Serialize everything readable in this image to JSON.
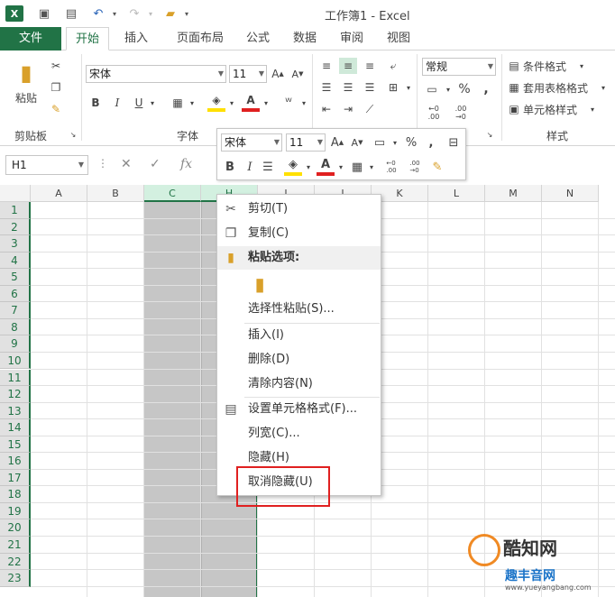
{
  "window": {
    "title": "工作簿1 - Excel"
  },
  "tabs": [
    {
      "label": "文件"
    },
    {
      "label": "开始"
    },
    {
      "label": "插入"
    },
    {
      "label": "页面布局"
    },
    {
      "label": "公式"
    },
    {
      "label": "数据"
    },
    {
      "label": "审阅"
    },
    {
      "label": "视图"
    }
  ],
  "ribbon": {
    "paste_label": "粘贴",
    "clipboard_group": "剪贴板",
    "font_name": "宋体",
    "font_size": "11",
    "font_group": "字体",
    "bold": "B",
    "italic": "I",
    "underline": "U",
    "font_color_letter": "A",
    "number_format": "常规",
    "percent": "%",
    "comma": ",",
    "cond_format": "条件格式",
    "table_format": "套用表格格式",
    "cell_style": "单元格样式",
    "styles_group": "样式",
    "inc_decimal": "←0 .00",
    "dec_decimal": ".00 →0"
  },
  "formula_bar": {
    "name_box": "H1",
    "fx": "fx"
  },
  "grid": {
    "columns": [
      "A",
      "B",
      "C",
      "H",
      "I",
      "J",
      "K",
      "L",
      "M",
      "N"
    ],
    "selected_columns": [
      "C",
      "H"
    ],
    "rows": [
      "1",
      "2",
      "3",
      "4",
      "5",
      "6",
      "7",
      "8",
      "9",
      "10",
      "11",
      "12",
      "13",
      "14",
      "15",
      "16",
      "17",
      "18",
      "19",
      "20",
      "21",
      "22",
      "23"
    ]
  },
  "mini_toolbar": {
    "font_name": "宋体",
    "font_size": "11",
    "bold": "B",
    "italic": "I",
    "percent": "%",
    "comma": ","
  },
  "context_menu": {
    "items": [
      {
        "label": "剪切(T)",
        "icon": "scissors-icon"
      },
      {
        "label": "复制(C)",
        "icon": "copy-icon"
      },
      {
        "label": "粘贴选项:",
        "icon": "paste-icon"
      },
      {
        "label": "选择性粘贴(S)...",
        "icon": ""
      },
      {
        "label": "插入(I)",
        "icon": ""
      },
      {
        "label": "删除(D)",
        "icon": ""
      },
      {
        "label": "清除内容(N)",
        "icon": ""
      },
      {
        "label": "设置单元格格式(F)...",
        "icon": "format-cells-icon"
      },
      {
        "label": "列宽(C)...",
        "icon": ""
      },
      {
        "label": "隐藏(H)",
        "icon": ""
      },
      {
        "label": "取消隐藏(U)",
        "icon": ""
      }
    ]
  },
  "watermark": {
    "name": "酷知网",
    "sub": "趣丰音网",
    "url": "www.yueyangbang.com"
  },
  "colors": {
    "excel_green": "#217346",
    "highlight_red": "#e02020"
  }
}
